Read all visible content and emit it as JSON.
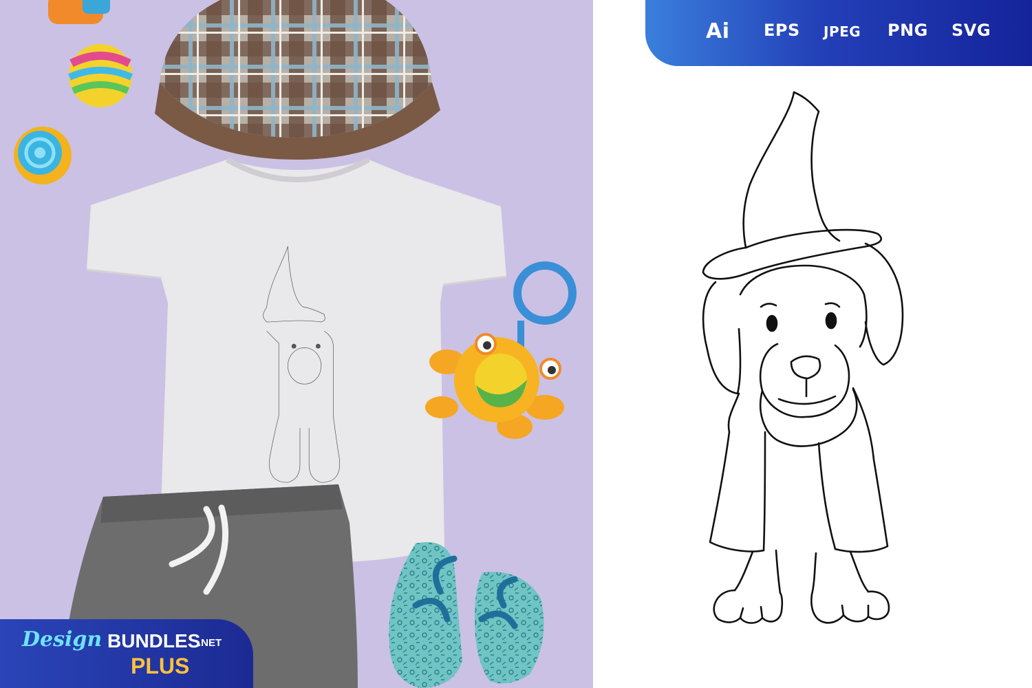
{
  "formats": {
    "ai": "Ai",
    "eps": "EPS",
    "jpeg": "JPEG",
    "png": "PNG",
    "svg": "SVG"
  },
  "brand": {
    "design": "Design",
    "bundles": "BUNDLES",
    "net": ".NET",
    "plus": "PLUS"
  },
  "colors": {
    "background_lilac": "#cbc1e4",
    "banner_blue_start": "#3a7fdc",
    "banner_blue_end": "#15239a",
    "brand_cyan": "#6ee3ff",
    "brand_gold": "#ffc23c"
  }
}
